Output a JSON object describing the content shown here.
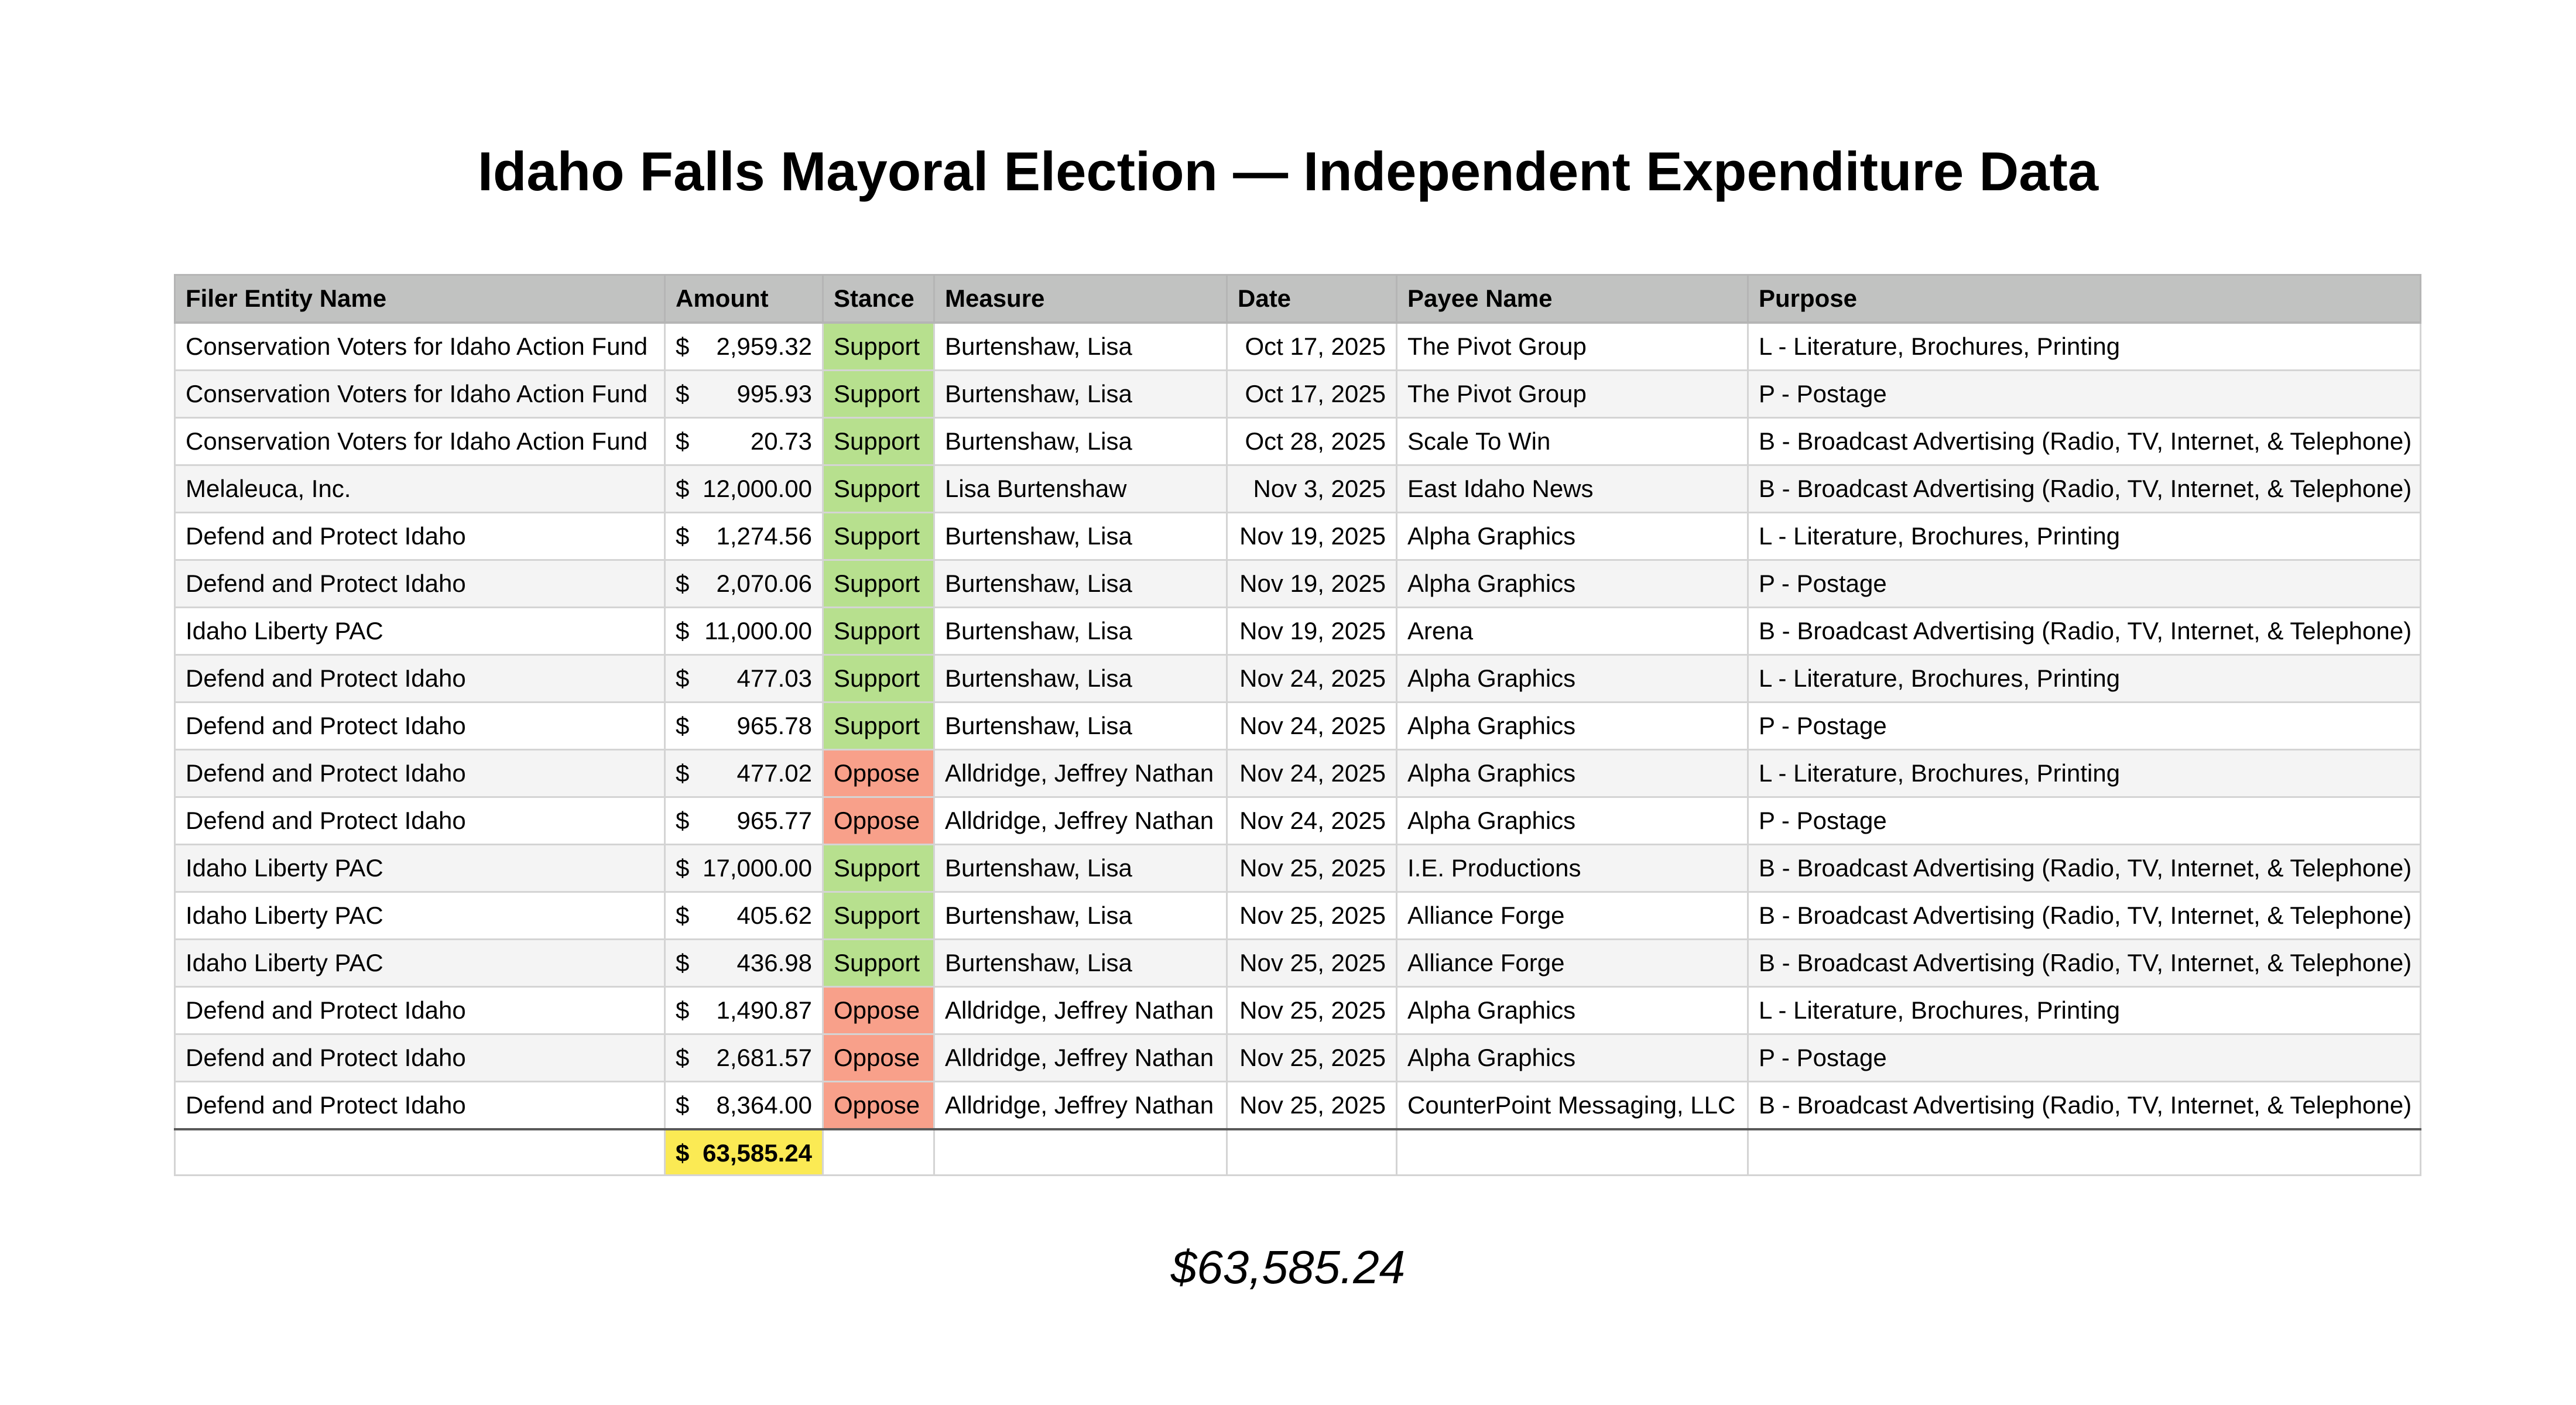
{
  "title": "Idaho Falls Mayoral Election — Independent Expenditure Data",
  "headers": [
    "Filer Entity Name",
    "Amount",
    "Stance",
    "Measure",
    "Date",
    "Payee Name",
    "Purpose"
  ],
  "currency_symbol": "$",
  "stance_colors": {
    "Support": "#b7e08e",
    "Oppose": "#f8a08a"
  },
  "rows": [
    {
      "filer": "Conservation Voters for Idaho Action Fund",
      "amount": "2,959.32",
      "stance": "Support",
      "measure": "Burtenshaw, Lisa",
      "date": "Oct 17, 2025",
      "payee": "The Pivot Group",
      "purpose": "L - Literature, Brochures, Printing"
    },
    {
      "filer": "Conservation Voters for Idaho Action Fund",
      "amount": "995.93",
      "stance": "Support",
      "measure": "Burtenshaw, Lisa",
      "date": "Oct 17, 2025",
      "payee": "The Pivot Group",
      "purpose": "P - Postage"
    },
    {
      "filer": "Conservation Voters for Idaho Action Fund",
      "amount": "20.73",
      "stance": "Support",
      "measure": "Burtenshaw, Lisa",
      "date": "Oct 28, 2025",
      "payee": "Scale To Win",
      "purpose": "B - Broadcast Advertising (Radio, TV, Internet, & Telephone)"
    },
    {
      "filer": "Melaleuca, Inc.",
      "amount": "12,000.00",
      "stance": "Support",
      "measure": "Lisa Burtenshaw",
      "date": "Nov 3, 2025",
      "payee": "East Idaho News",
      "purpose": "B - Broadcast Advertising (Radio, TV, Internet, & Telephone)"
    },
    {
      "filer": "Defend and Protect Idaho",
      "amount": "1,274.56",
      "stance": "Support",
      "measure": "Burtenshaw, Lisa",
      "date": "Nov 19, 2025",
      "payee": "Alpha Graphics",
      "purpose": "L - Literature, Brochures, Printing"
    },
    {
      "filer": "Defend and Protect Idaho",
      "amount": "2,070.06",
      "stance": "Support",
      "measure": "Burtenshaw, Lisa",
      "date": "Nov 19, 2025",
      "payee": "Alpha Graphics",
      "purpose": "P - Postage"
    },
    {
      "filer": "Idaho Liberty PAC",
      "amount": "11,000.00",
      "stance": "Support",
      "measure": "Burtenshaw, Lisa",
      "date": "Nov 19, 2025",
      "payee": "Arena",
      "purpose": "B - Broadcast Advertising (Radio, TV, Internet, & Telephone)"
    },
    {
      "filer": "Defend and Protect Idaho",
      "amount": "477.03",
      "stance": "Support",
      "measure": "Burtenshaw, Lisa",
      "date": "Nov 24, 2025",
      "payee": "Alpha Graphics",
      "purpose": "L - Literature, Brochures, Printing"
    },
    {
      "filer": "Defend and Protect Idaho",
      "amount": "965.78",
      "stance": "Support",
      "measure": "Burtenshaw, Lisa",
      "date": "Nov 24, 2025",
      "payee": "Alpha Graphics",
      "purpose": "P - Postage"
    },
    {
      "filer": "Defend and Protect Idaho",
      "amount": "477.02",
      "stance": "Oppose",
      "measure": "Alldridge, Jeffrey Nathan",
      "date": "Nov 24, 2025",
      "payee": "Alpha Graphics",
      "purpose": "L - Literature, Brochures, Printing"
    },
    {
      "filer": "Defend and Protect Idaho",
      "amount": "965.77",
      "stance": "Oppose",
      "measure": "Alldridge, Jeffrey Nathan",
      "date": "Nov 24, 2025",
      "payee": "Alpha Graphics",
      "purpose": "P - Postage"
    },
    {
      "filer": "Idaho Liberty PAC",
      "amount": "17,000.00",
      "stance": "Support",
      "measure": "Burtenshaw, Lisa",
      "date": "Nov 25, 2025",
      "payee": "I.E. Productions",
      "purpose": "B - Broadcast Advertising (Radio, TV, Internet, & Telephone)"
    },
    {
      "filer": "Idaho Liberty PAC",
      "amount": "405.62",
      "stance": "Support",
      "measure": "Burtenshaw, Lisa",
      "date": "Nov 25, 2025",
      "payee": "Alliance Forge",
      "purpose": "B - Broadcast Advertising (Radio, TV, Internet, & Telephone)"
    },
    {
      "filer": "Idaho Liberty PAC",
      "amount": "436.98",
      "stance": "Support",
      "measure": "Burtenshaw, Lisa",
      "date": "Nov 25, 2025",
      "payee": "Alliance Forge",
      "purpose": "B - Broadcast Advertising (Radio, TV, Internet, & Telephone)"
    },
    {
      "filer": "Defend and Protect Idaho",
      "amount": "1,490.87",
      "stance": "Oppose",
      "measure": "Alldridge, Jeffrey Nathan",
      "date": "Nov 25, 2025",
      "payee": "Alpha Graphics",
      "purpose": "L - Literature, Brochures, Printing"
    },
    {
      "filer": "Defend and Protect Idaho",
      "amount": "2,681.57",
      "stance": "Oppose",
      "measure": "Alldridge, Jeffrey Nathan",
      "date": "Nov 25, 2025",
      "payee": "Alpha Graphics",
      "purpose": "P - Postage"
    },
    {
      "filer": "Defend and Protect Idaho",
      "amount": "8,364.00",
      "stance": "Oppose",
      "measure": "Alldridge, Jeffrey Nathan",
      "date": "Nov 25, 2025",
      "payee": "CounterPoint Messaging, LLC",
      "purpose": "B - Broadcast Advertising (Radio, TV, Internet, & Telephone)"
    }
  ],
  "total_amount": "63,585.24",
  "total_highlight_color": "#fbea54",
  "grand_total_display": "$63,585.24"
}
